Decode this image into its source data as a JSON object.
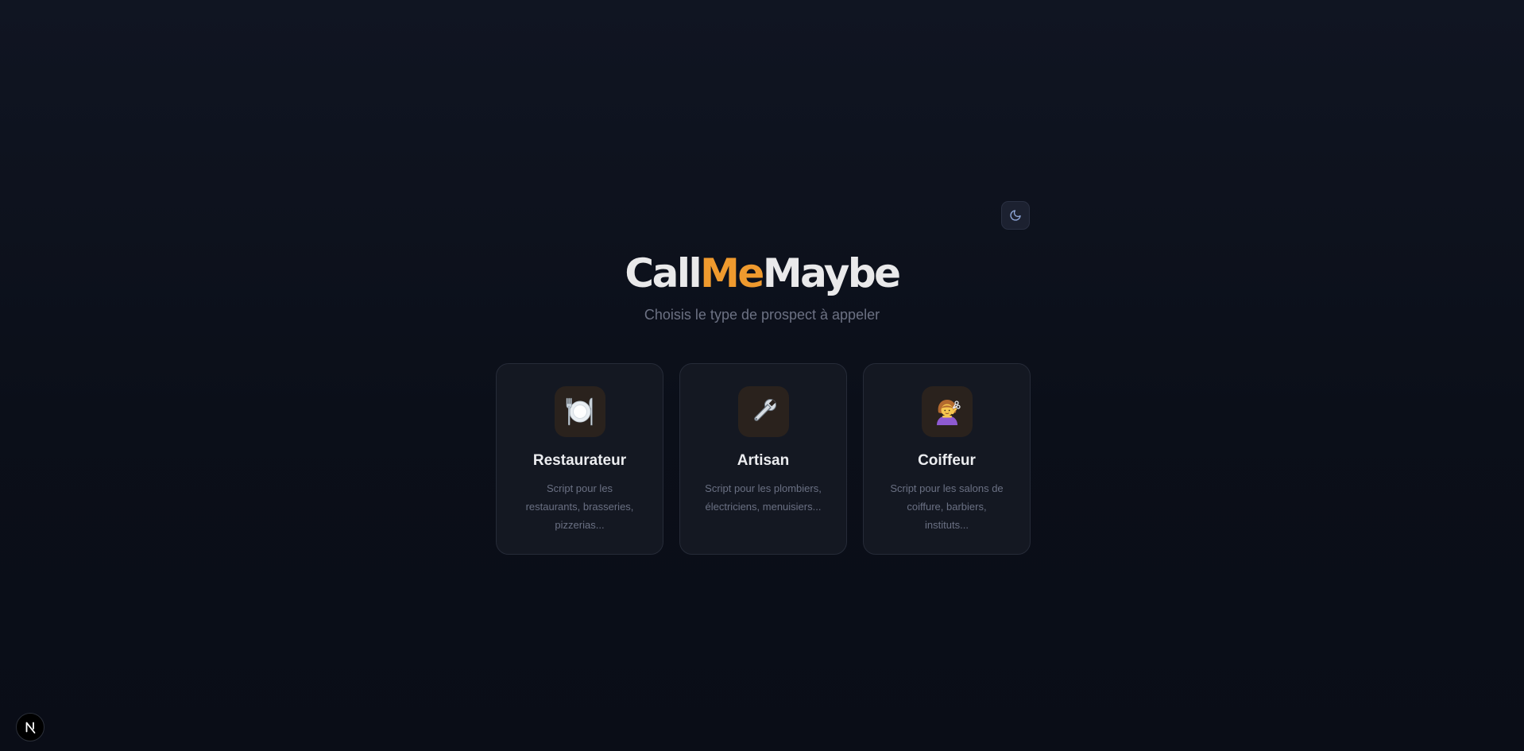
{
  "title": {
    "part1": "Call",
    "accent": "Me",
    "part2": "Maybe"
  },
  "subtitle": "Choisis le type de prospect à appeler",
  "theme_toggle": {
    "icon": "moon-icon"
  },
  "cards": [
    {
      "icon": "plate-cutlery-icon",
      "title": "Restaurateur",
      "description": "Script pour les restaurants, brasseries, pizzerias..."
    },
    {
      "icon": "wrench-icon",
      "title": "Artisan",
      "description": "Script pour les plombiers, électriciens, menuisiers..."
    },
    {
      "icon": "hairdresser-icon",
      "title": "Coiffeur",
      "description": "Script pour les salons de coiffure, barbiers, instituts..."
    }
  ],
  "dev_badge": {
    "icon": "nextjs-icon"
  },
  "colors": {
    "accent": "#ef9a2e",
    "background": "#0b0f19",
    "card": "#141822",
    "icon_tile": "#2a221d"
  }
}
